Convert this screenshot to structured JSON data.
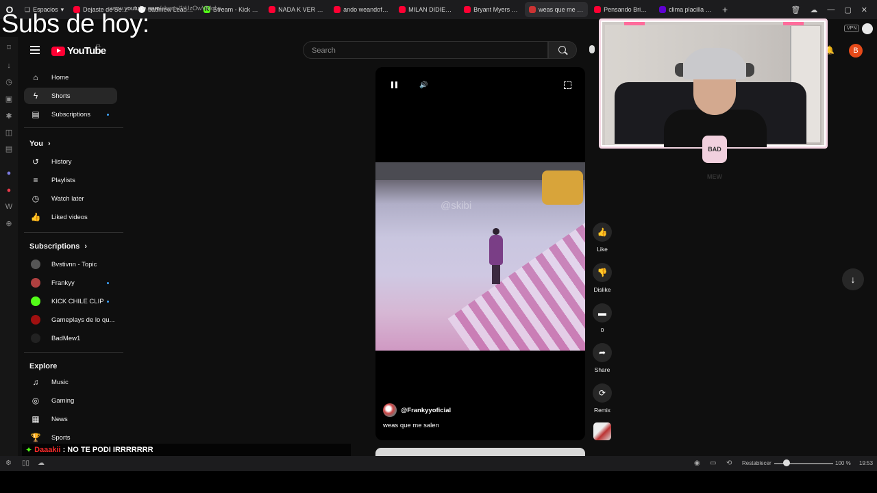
{
  "overlay": {
    "caption": "Subs de hoy:",
    "chat_user": "Daaakii",
    "chat_sep": ":",
    "chat_msg": "NO TE PODI IRRRRRRR",
    "cam_logo": "BAD MEW"
  },
  "browser": {
    "spaces_label": "Espacios",
    "tabs": [
      {
        "title": "Dejaste de Ser Santa",
        "icon": "yt"
      },
      {
        "title": "badmew LeaderBoar",
        "icon": "gh"
      },
      {
        "title": "Stream - Kick Dashb",
        "icon": "k"
      },
      {
        "title": "NADA K VER - Benji I",
        "icon": "yt"
      },
      {
        "title": "ando weandoft alan",
        "icon": "yt"
      },
      {
        "title": "MILAN DIDIER & JEF",
        "icon": "yt"
      },
      {
        "title": "Bryant Myers x Cris I",
        "icon": "yt"
      },
      {
        "title": "weas que me salen",
        "icon": "sp",
        "active": true
      },
      {
        "title": "Pensando Brigido (D",
        "icon": "yt"
      },
      {
        "title": "clima placilla valpara",
        "icon": "y"
      }
    ],
    "url_prefix": "www.",
    "url_domain": "youtube.com",
    "url_path": "/shorts/1tUzOwVMqLs",
    "vpn_label": "VPN"
  },
  "youtube": {
    "logo_text": "YouTube",
    "country": "CL",
    "search_placeholder": "Search",
    "avatar_letter": "B",
    "nav": [
      {
        "label": "Home",
        "icon": "⌂"
      },
      {
        "label": "Shorts",
        "icon": "ϟ",
        "active": true
      },
      {
        "label": "Subscriptions",
        "icon": "▤",
        "dot": true
      }
    ],
    "you_header": "You",
    "you_items": [
      {
        "label": "History",
        "icon": "↺"
      },
      {
        "label": "Playlists",
        "icon": "≡"
      },
      {
        "label": "Watch later",
        "icon": "◷"
      },
      {
        "label": "Liked videos",
        "icon": "👍"
      }
    ],
    "subs_header": "Subscriptions",
    "subs": [
      {
        "label": "Bvstivnn - Topic",
        "color": "#555555"
      },
      {
        "label": "Frankyy",
        "color": "#b04040",
        "dot": true
      },
      {
        "label": "KICK CHILE CLIP",
        "color": "#53fc18",
        "dot": true
      },
      {
        "label": "Gameplays de lo qu...",
        "color": "#a01010"
      },
      {
        "label": "BadMew1",
        "color": "#222222"
      }
    ],
    "explore_header": "Explore",
    "explore": [
      {
        "label": "Music",
        "icon": "♫"
      },
      {
        "label": "Gaming",
        "icon": "◎"
      },
      {
        "label": "News",
        "icon": "▦"
      },
      {
        "label": "Sports",
        "icon": "🏆"
      }
    ],
    "short": {
      "channel": "@Frankyyoficial",
      "title": "weas que me salen",
      "watermark": "@skibi"
    },
    "actions": {
      "like": "Like",
      "dislike": "Dislike",
      "comments": "0",
      "share": "Share",
      "remix": "Remix"
    }
  },
  "statusbar": {
    "reset": "Restablecer",
    "zoom": "100 %",
    "clock": "19:53"
  }
}
